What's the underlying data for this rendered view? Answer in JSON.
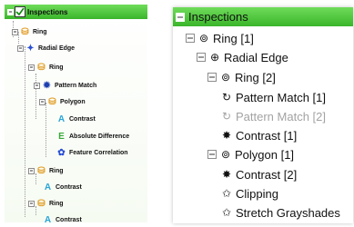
{
  "left": {
    "header": "Inspections",
    "items": [
      {
        "label": "Ring",
        "icon": "ring-icon"
      },
      {
        "label": "Radial Edge",
        "icon": "radial-edge-icon"
      },
      {
        "label": "Ring",
        "icon": "ring-icon"
      },
      {
        "label": "Pattern Match",
        "icon": "pattern-match-icon"
      },
      {
        "label": "Polygon",
        "icon": "polygon-icon"
      },
      {
        "label": "Contrast",
        "icon": "contrast-icon"
      },
      {
        "label": "Absolute Difference",
        "icon": "absolute-difference-icon"
      },
      {
        "label": "Feature Correlation",
        "icon": "feature-correlation-icon"
      },
      {
        "label": "Ring",
        "icon": "ring-icon"
      },
      {
        "label": "Contrast",
        "icon": "contrast-icon"
      },
      {
        "label": "Ring",
        "icon": "ring-icon"
      },
      {
        "label": "Contrast",
        "icon": "contrast-icon"
      }
    ]
  },
  "right": {
    "header": "Inspections",
    "items": [
      {
        "label": "Ring [1]",
        "icon": "ring-icon"
      },
      {
        "label": "Radial Edge",
        "icon": "radial-edge-icon"
      },
      {
        "label": "Ring [2]",
        "icon": "ring-icon"
      },
      {
        "label": "Pattern Match [1]",
        "icon": "pattern-match-icon"
      },
      {
        "label": "Pattern Match [2]",
        "icon": "pattern-match-icon"
      },
      {
        "label": "Contrast [1]",
        "icon": "contrast-icon"
      },
      {
        "label": "Polygon [1]",
        "icon": "polygon-icon"
      },
      {
        "label": "Contrast [2]",
        "icon": "contrast-icon"
      },
      {
        "label": "Clipping",
        "icon": "clipping-icon"
      },
      {
        "label": "Stretch Grayshades",
        "icon": "stretch-grayshades-icon"
      }
    ]
  },
  "colors": {
    "header_green": "#4cc43a",
    "tree_line": "#9a9a9a",
    "disabled_text": "#a3a3a3"
  }
}
